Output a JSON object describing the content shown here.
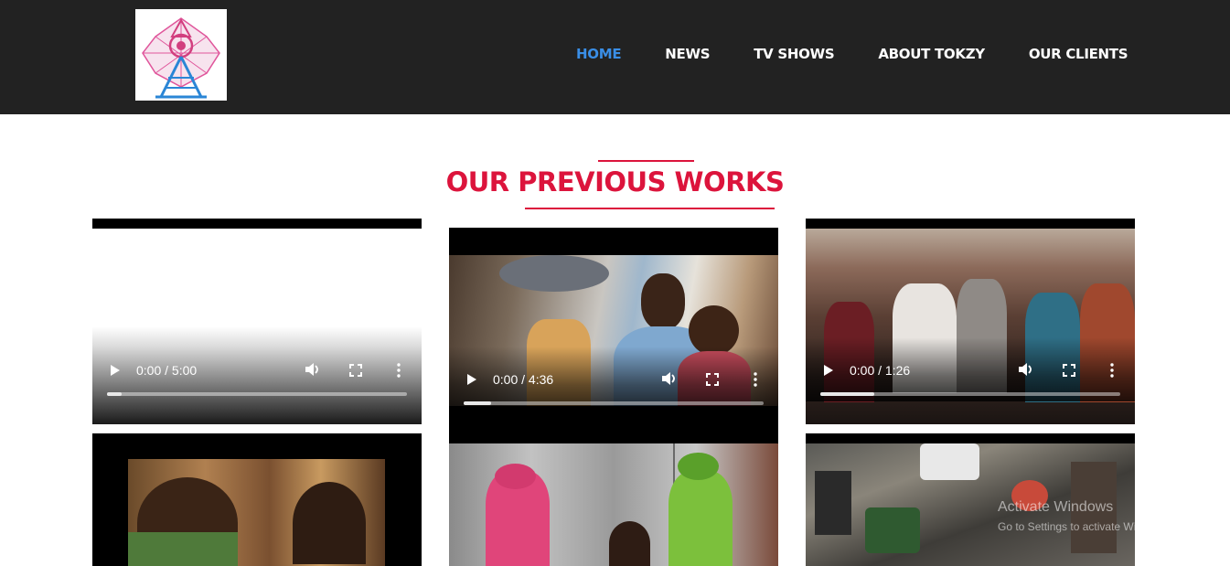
{
  "nav": {
    "items": [
      {
        "label": "HOME",
        "active": true
      },
      {
        "label": "NEWS",
        "active": false
      },
      {
        "label": "TV SHOWS",
        "active": false
      },
      {
        "label": "ABOUT TOKZY",
        "active": false
      },
      {
        "label": "OUR CLIENTS",
        "active": false
      }
    ],
    "active_color": "#3a8ee6"
  },
  "section": {
    "title": "OUR PREVIOUS WORKS",
    "accent_color": "#dc143c"
  },
  "videos": [
    {
      "time": "0:00 / 5:00",
      "progress": 0.05
    },
    {
      "time": "0:00 / 4:36",
      "progress": 0.09
    },
    {
      "time": "0:00 / 1:26",
      "progress": 0.18
    },
    {
      "time": "",
      "progress": 0
    },
    {
      "time": "",
      "progress": 0
    },
    {
      "time": "",
      "progress": 0
    }
  ],
  "icons": [
    "play-icon",
    "volume-icon",
    "fullscreen-icon",
    "more-options-icon",
    "tower-logo-icon"
  ],
  "watermark": {
    "line1": "Activate Windows",
    "line2": "Go to Settings to activate Windows."
  }
}
